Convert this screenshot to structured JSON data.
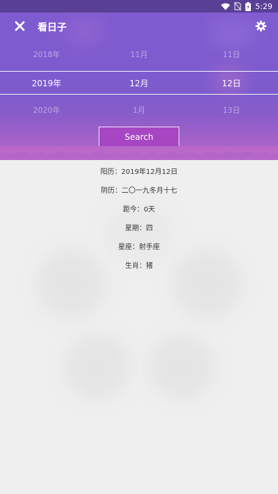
{
  "status_bar": {
    "time": "5:29"
  },
  "app": {
    "title": "看日子"
  },
  "picker": {
    "previous": {
      "year": "2018年",
      "month": "11月",
      "day": "11日"
    },
    "selected": {
      "year": "2019年",
      "month": "12月",
      "day": "12日"
    },
    "next": {
      "year": "2020年",
      "month": "1月",
      "day": "13日"
    }
  },
  "search": {
    "label": "Search"
  },
  "results": [
    {
      "label": "阳历：",
      "value": "2019年12月12日"
    },
    {
      "label": "阴历：",
      "value": "二〇一九冬月十七"
    },
    {
      "label": "距今：",
      "value": "0天"
    },
    {
      "label": "星期：",
      "value": "四"
    },
    {
      "label": "星座：",
      "value": "射手座"
    },
    {
      "label": "生肖：",
      "value": "猪"
    }
  ],
  "colors": {
    "header_top": "#7f5bd0",
    "header_bottom": "#b767c8",
    "search_button": "#a646c3",
    "status_bar": "#5a3f96",
    "background": "#efefef"
  }
}
